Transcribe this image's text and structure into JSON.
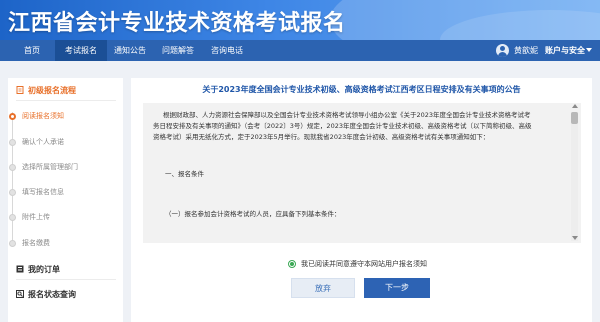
{
  "header": {
    "title": "江西省会计专业技术资格考试报名"
  },
  "nav": {
    "items": [
      "首页",
      "考试报名",
      "通知公告",
      "问题解答",
      "咨询电话"
    ],
    "active_index": 1,
    "user_name": "黄歆妮",
    "account_label": "账户与安全"
  },
  "sidebar": {
    "process_title": "初级报名流程",
    "steps": [
      "阅读报名须知",
      "确认个人承诺",
      "选择所属管理部门",
      "填写报名信息",
      "附件上传",
      "报名缴费"
    ],
    "active_step": 0,
    "orders_label": "我的订单",
    "status_label": "报名状态查询"
  },
  "notice": {
    "title": "关于2023年度全国会计专业技术初级、高级资格考试江西考区日程安排及有关事项的公告",
    "para1_line1": "根据财政部、人力资源社会保障部以及全国会计专业技术资格考试领导小组办公室《关于2023年度全国会计专业技术资格考试考",
    "para1_line2": "务日程安排及有关事项的通知》（会考〔2022〕3号）规定，2023年度全国会计专业技术初级、高级资格考试（以下简称初级、高级",
    "para1_line3": "资格考试）采用无纸化方式，定于2023年5月举行。现就我省2023年度会计初级、高级资格考试有关事项通知如下：",
    "section1": "一、报名条件",
    "section1_sub": "（一）报名参加会计资格考试的人员，应具备下列基本条件："
  },
  "agree_text": "我已阅读并同意遵守本网站用户报名须知",
  "buttons": {
    "cancel": "放弃",
    "next": "下一步"
  },
  "colors": {
    "primary": "#2c63b1",
    "accent": "#e8702a",
    "success": "#3aa854"
  }
}
